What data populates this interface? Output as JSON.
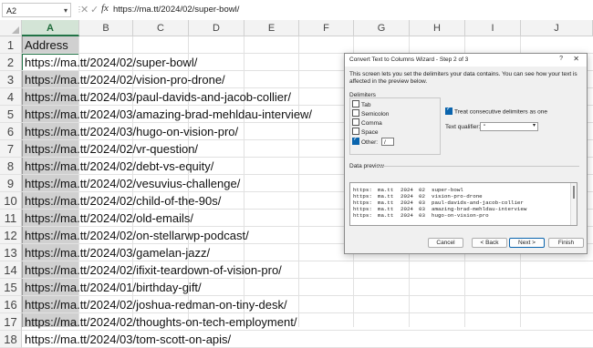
{
  "formula_bar": {
    "name_box": "A2",
    "fx_label": "fx",
    "content": "https://ma.tt/2024/02/super-bowl/"
  },
  "columns": [
    "A",
    "B",
    "C",
    "D",
    "E",
    "F",
    "G",
    "H",
    "I",
    "J"
  ],
  "rows": [
    {
      "num": "1",
      "value": "Address"
    },
    {
      "num": "2",
      "value": "https://ma.tt/2024/02/super-bowl/"
    },
    {
      "num": "3",
      "value": "https://ma.tt/2024/02/vision-pro-drone/"
    },
    {
      "num": "4",
      "value": "https://ma.tt/2024/03/paul-davids-and-jacob-collier/"
    },
    {
      "num": "5",
      "value": "https://ma.tt/2024/03/amazing-brad-mehldau-interview/"
    },
    {
      "num": "6",
      "value": "https://ma.tt/2024/03/hugo-on-vision-pro/"
    },
    {
      "num": "7",
      "value": "https://ma.tt/2024/02/vr-question/"
    },
    {
      "num": "8",
      "value": "https://ma.tt/2024/02/debt-vs-equity/"
    },
    {
      "num": "9",
      "value": "https://ma.tt/2024/02/vesuvius-challenge/"
    },
    {
      "num": "10",
      "value": "https://ma.tt/2024/02/child-of-the-90s/"
    },
    {
      "num": "11",
      "value": "https://ma.tt/2024/02/old-emails/"
    },
    {
      "num": "12",
      "value": "https://ma.tt/2024/02/on-stellarwp-podcast/"
    },
    {
      "num": "13",
      "value": "https://ma.tt/2024/03/gamelan-jazz/"
    },
    {
      "num": "14",
      "value": "https://ma.tt/2024/02/ifixit-teardown-of-vision-pro/"
    },
    {
      "num": "15",
      "value": "https://ma.tt/2024/01/birthday-gift/"
    },
    {
      "num": "16",
      "value": "https://ma.tt/2024/02/joshua-redman-on-tiny-desk/"
    },
    {
      "num": "17",
      "value": "https://ma.tt/2024/02/thoughts-on-tech-employment/"
    },
    {
      "num": "18",
      "value": "https://ma.tt/2024/03/tom-scott-on-apis/"
    }
  ],
  "dialog": {
    "title": "Convert Text to Columns Wizard - Step 2 of 3",
    "help": "?",
    "close": "✕",
    "description": "This screen lets you set the delimiters your data contains. You can see how your text is affected in the preview below.",
    "delimiters_label": "Delimiters",
    "delimiters": [
      {
        "label": "Tab",
        "checked": false
      },
      {
        "label": "Semicolon",
        "checked": false
      },
      {
        "label": "Comma",
        "checked": false
      },
      {
        "label": "Space",
        "checked": false
      },
      {
        "label": "Other:",
        "checked": true
      }
    ],
    "other_value": "/",
    "consecutive_label": "Treat consecutive delimiters as one",
    "consecutive_checked": true,
    "qualifier_label": "Text qualifier:",
    "qualifier_value": "\"",
    "preview_label": "Data preview",
    "preview_rows": [
      [
        "https:",
        "ma.tt",
        "2024",
        "02",
        "super-bowl"
      ],
      [
        "https:",
        "ma.tt",
        "2024",
        "02",
        "vision-pro-drone"
      ],
      [
        "https:",
        "ma.tt",
        "2024",
        "03",
        "paul-davids-and-jacob-collier"
      ],
      [
        "https:",
        "ma.tt",
        "2024",
        "03",
        "amazing-brad-mehldau-interview"
      ],
      [
        "https:",
        "ma.tt",
        "2024",
        "03",
        "hugo-on-vision-pro"
      ]
    ],
    "buttons": {
      "cancel": "Cancel",
      "back": "< Back",
      "next": "Next >",
      "finish": "Finish"
    }
  }
}
